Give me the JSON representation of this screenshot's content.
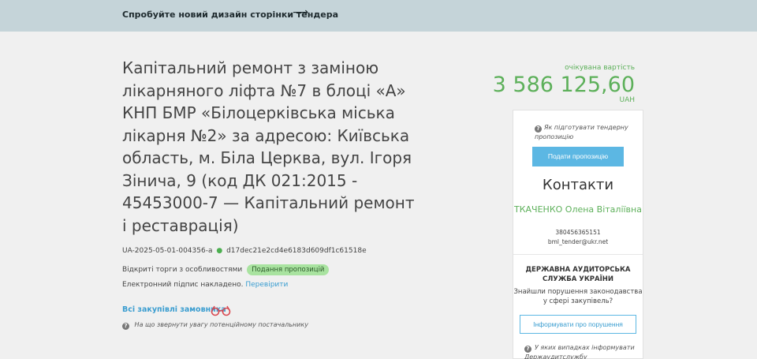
{
  "banner": {
    "link_text": "Спробуйте новий дизайн сторінки тендера",
    "arrow": "⟶"
  },
  "tender": {
    "title": "Капітальний ремонт з заміною лікарняного ліфта №7 в блоці «А» КНП БМР «Білоцерківська міська лікарня №2» за адресою: Київська область, м. Біла Церква, вул. Ігоря Зінича, 9 (код ДК 021:2015 - 45453000-7 — Капітальний ремонт і реставрація)",
    "id": "UA-2025-05-01-004356-a",
    "hash": "d17dec21e2cd4e6183d609df1c61518e",
    "procedure": "Відкриті торги з особливостями",
    "status_badge": "Подання пропозицій",
    "signature_text": "Електронний підпис накладено.",
    "signature_link": "Перевірити",
    "all_purchases": "Всі закупівлі замовника",
    "hint": "На що звернути увагу потенційному постачальнику"
  },
  "price": {
    "label": "очікувана вартість",
    "value": "3 586 125,60",
    "currency": "UAH"
  },
  "panel": {
    "how_to": "Як підготувати тендерну пропозицію",
    "submit_label": "Подати пропозицію",
    "contacts_title": "Контакти",
    "contact_name": "ТКАЧЕНКО Олена Віталіївна",
    "contact_phone": "380456365151",
    "contact_email": "bml_tender@ukr.net",
    "audit_title": "ДЕРЖАВНА АУДИТОРСЬКА СЛУЖБА УКРАЇНИ",
    "audit_sub": "Знайшли порушення законодавства у сфері закупівель?",
    "report_label": "Інформувати про порушення",
    "audit_hint": "У яких випадках інформувати Держаудитслужбу"
  },
  "colors": {
    "banner_bg": "#c5d4d9",
    "accent_green": "#5db05a",
    "accent_blue": "#5cb7e3",
    "badge_green": "#a9e3a0"
  },
  "icons": {
    "question": "question-icon",
    "glasses": "glasses-icon",
    "arrow": "arrow-right-icon"
  }
}
